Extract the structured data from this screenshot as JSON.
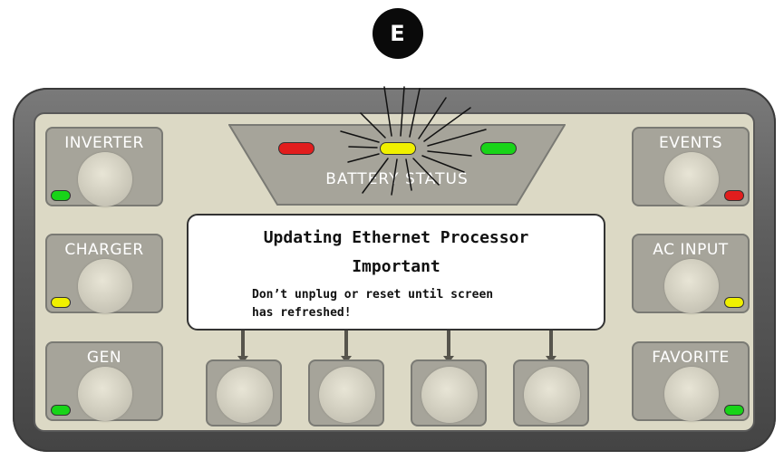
{
  "callout": {
    "letter": "E"
  },
  "buttons": {
    "inverter": {
      "label": "INVERTER",
      "led": "green"
    },
    "charger": {
      "label": "CHARGER",
      "led": "yellow"
    },
    "gen": {
      "label": "GEN",
      "led": "green"
    },
    "events": {
      "label": "EVENTS",
      "led": "red"
    },
    "ac_input": {
      "label": "AC INPUT",
      "led": "yellow"
    },
    "favorite": {
      "label": "FAVORITE",
      "led": "green"
    }
  },
  "battery_status": {
    "label": "BATTERY STATUS",
    "leds": [
      "red",
      "yellow",
      "green"
    ],
    "active_led": "yellow"
  },
  "display": {
    "line1": "Updating Ethernet Processor",
    "line2": "Important",
    "message_line1": "Don’t unplug or reset until screen",
    "message_line2": "has refreshed!"
  },
  "colors": {
    "green": "#18d418",
    "yellow": "#f0f000",
    "red": "#e21d1d",
    "panel": "#dcd9c5",
    "button": "#a6a49a"
  }
}
